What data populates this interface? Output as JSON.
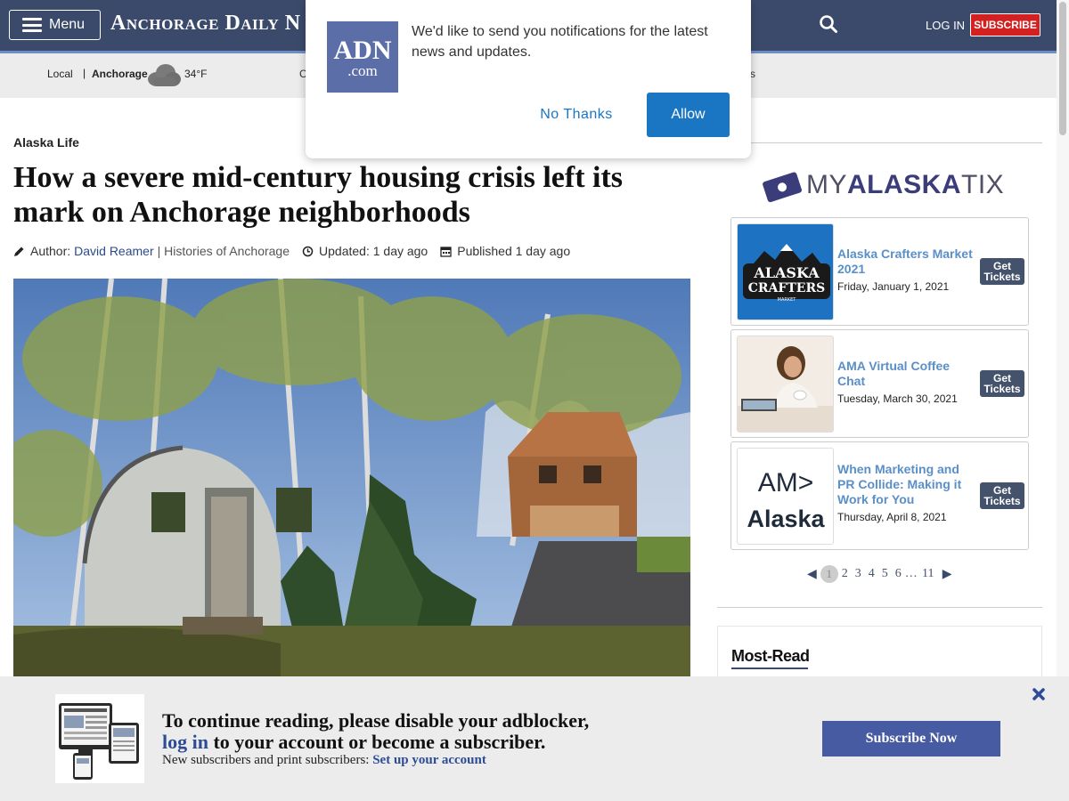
{
  "header": {
    "menu_label": "Menu",
    "masthead": "Anchorage Daily N",
    "login_label": "LOG IN",
    "subscribe_label": "SUBSCRIBE",
    "search_icon": "search-icon"
  },
  "subnav": {
    "local": "Local",
    "separator": "|",
    "city": "Anchorage",
    "weather_icon": "cloud-icon",
    "temperature": "34°F",
    "partial_left": "C",
    "partial_right": "s"
  },
  "article": {
    "section": "Alaska Life",
    "headline": "How a severe mid-century housing crisis left its mark on Anchorage neighborhoods",
    "author_prefix": "Author:",
    "author": "David Reamer",
    "series": "| Histories of Anchorage",
    "updated": "Updated: 1 day ago",
    "published": "Published 1 day ago"
  },
  "sidebar": {
    "tix_logo": {
      "my": "MY",
      "alaska": "ALASKA",
      "tix": "TIX"
    },
    "events": [
      {
        "title": "Alaska Crafters Market 2021",
        "date": "Friday, January 1, 2021",
        "button": "Get Tickets",
        "thumb_text_1": "ALASKA",
        "thumb_text_2": "CRAFTERS",
        "thumb_text_3": "MARKET"
      },
      {
        "title": "AMA Virtual Coffee Chat",
        "date": "Tuesday, March 30, 2021",
        "button": "Get Tickets"
      },
      {
        "title": "When Marketing and PR Collide: Making it Work for You",
        "date": "Thursday, April 8, 2021",
        "button": "Get Tickets",
        "thumb_text_1": "AM>",
        "thumb_text_2": "Alaska"
      }
    ],
    "pager": {
      "prev": "◀",
      "pages": [
        "1",
        "2",
        "3",
        "4",
        "5",
        "6"
      ],
      "ellipsis": "…",
      "last": "11",
      "next": "▶",
      "active_page": 1
    },
    "most_read": "Most-Read"
  },
  "notification": {
    "logo_big": "ADN",
    "logo_small": ".com",
    "message": "We'd like to send you notifications for the latest news and updates.",
    "no_label": "No Thanks",
    "allow_label": "Allow"
  },
  "adblock": {
    "line1": "To continue reading, please disable your adblocker,",
    "line2_link": "log in",
    "line2_rest": " to your account or become a subscriber.",
    "line3_text": "New subscribers and print subscribers: ",
    "line3_link": "Set up your account",
    "subscribe_label": "Subscribe Now",
    "close_icon": "close-icon"
  },
  "colors": {
    "header_bg": "#3b4a6b",
    "subscribe_red": "#d32020",
    "event_title": "#5a8fc7",
    "allow_blue": "#1a76c2",
    "subscribe_now": "#475ba3"
  }
}
